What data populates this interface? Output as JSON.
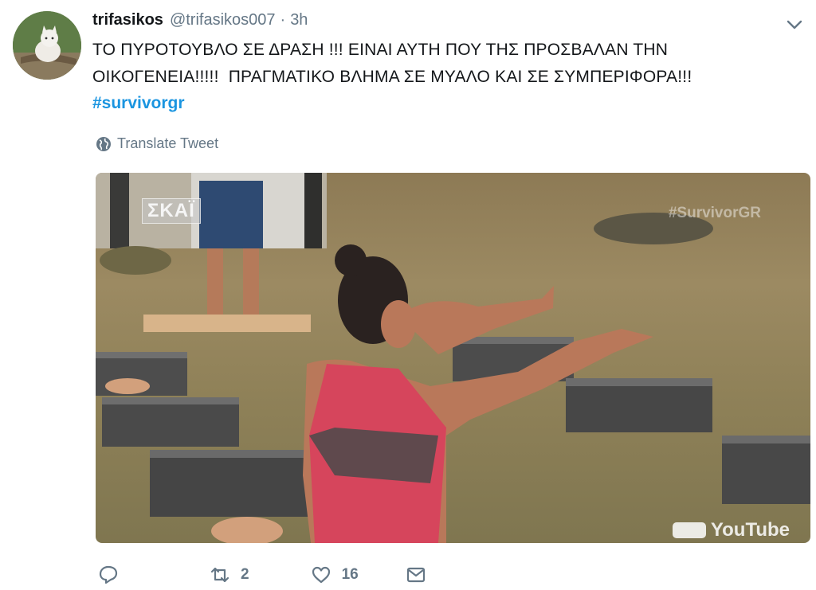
{
  "tweet": {
    "display_name": "trifasikos",
    "handle": "@trifasikos007",
    "separator": "·",
    "time": "3h",
    "text_line1": "ΤΟ ΠΥΡΟΤΟΥΒΛΟ ΣΕ ΔΡΑΣΗ !!! ΕΙΝΑΙ ΑΥΤΗ ΠΟΥ ΤΗΣ ΠΡΟΣΒΑΛΑΝ ΤΗΝ",
    "text_line2": "ΟΙΚΟΓΕΝΕΙΑ!!!!!  ΠΡΑΓΜΑΤΙΚΟ ΒΛΗΜΑ ΣΕ ΜΥΑΛΟ ΚΑΙ ΣΕ ΣΥΜΠΕΡΙΦΟΡΑ!!!",
    "hashtag": "#survivorgr",
    "translate_label": "Translate Tweet"
  },
  "media": {
    "channel_logo": "ΣΚΑΪ",
    "watermark": "#SurvivorGR",
    "youtube_label": "YouTube"
  },
  "actions": {
    "reply_icon": "reply-icon",
    "retweet_icon": "retweet-icon",
    "retweet_count": "2",
    "like_icon": "heart-icon",
    "like_count": "16",
    "message_icon": "envelope-icon"
  },
  "colors": {
    "link": "#1b95e0",
    "secondary_text": "#657786",
    "primary_text": "#14171a",
    "tank_top": "#d6455c"
  }
}
